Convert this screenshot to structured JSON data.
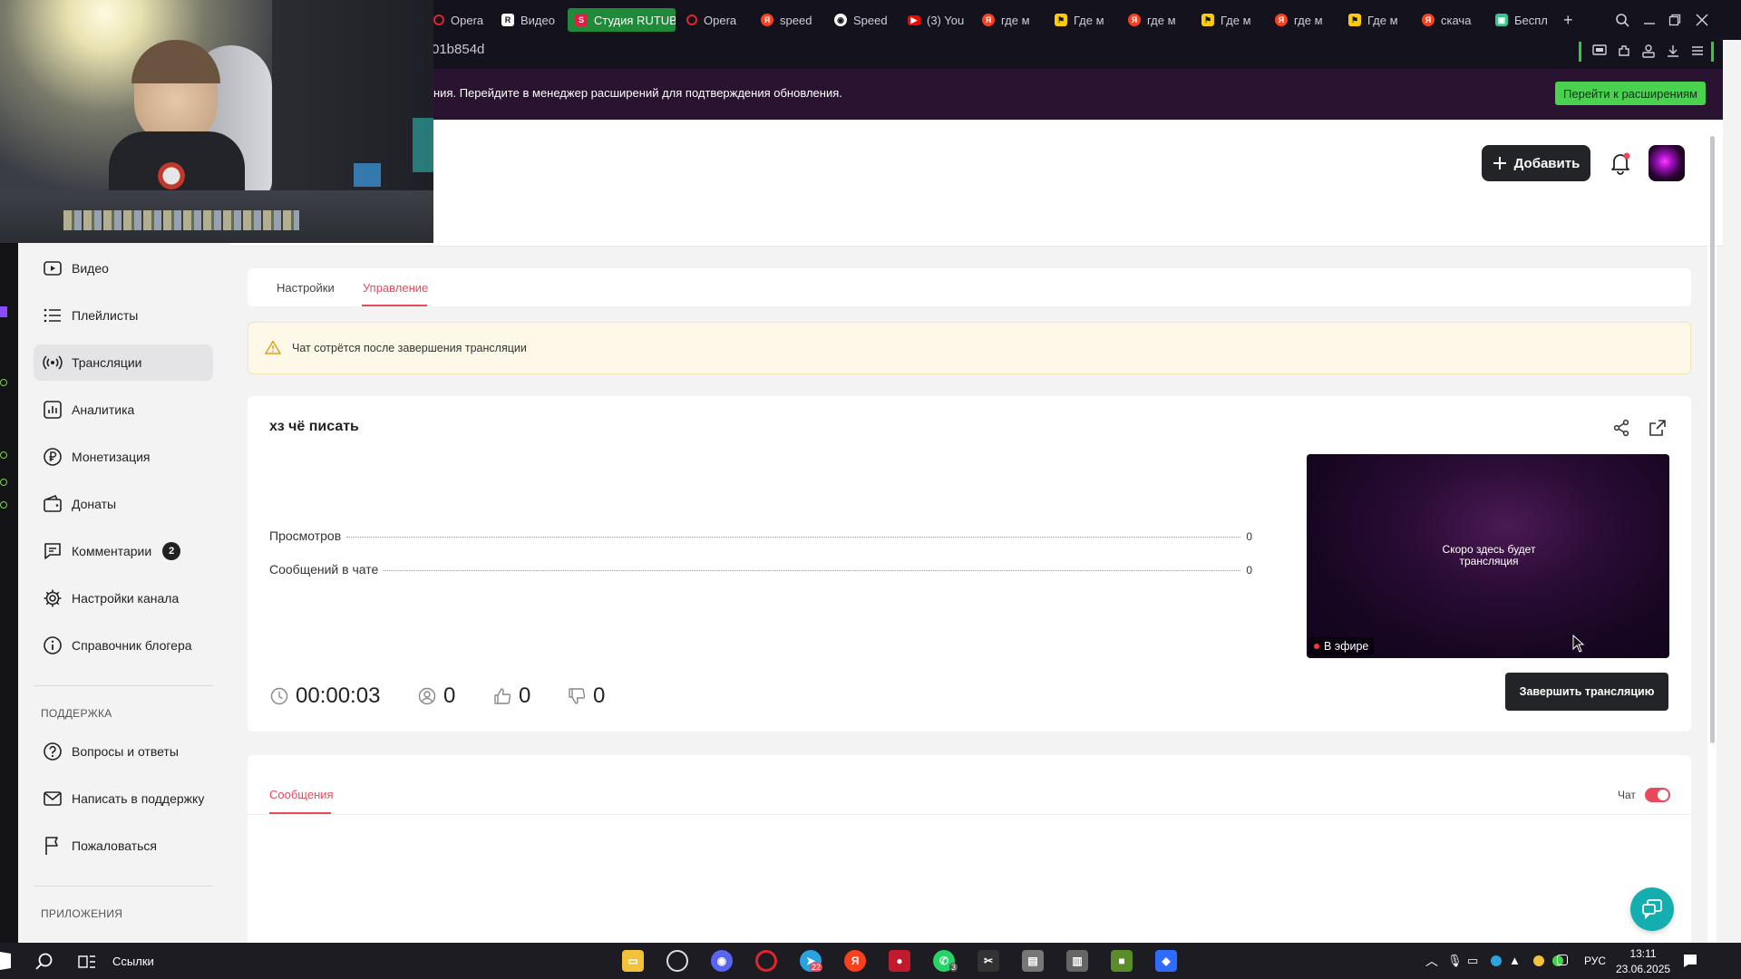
{
  "browser": {
    "tabs": [
      {
        "label": "Opera",
        "icon": "opera-icon",
        "color": "#e0262b"
      },
      {
        "label": "Видео",
        "icon": "rutube-icon",
        "color": "#ffffff"
      },
      {
        "label": "Студия RUTUBE",
        "icon": "rutube-studio-icon",
        "color": "#e01f45",
        "active": true
      },
      {
        "label": "Opera",
        "icon": "opera-icon",
        "color": "#e0262b"
      },
      {
        "label": "speed",
        "icon": "yandex-icon",
        "color": "#fc3f1d"
      },
      {
        "label": "Speed",
        "icon": "github-icon",
        "color": "#ffffff"
      },
      {
        "label": "(3) You",
        "icon": "youtube-icon",
        "color": "#ff0000"
      },
      {
        "label": "где м",
        "icon": "yandex-icon",
        "color": "#fc3f1d"
      },
      {
        "label": "Где м",
        "icon": "yandex-maps-icon",
        "color": "#ffcc00"
      },
      {
        "label": "где м",
        "icon": "yandex-icon",
        "color": "#fc3f1d"
      },
      {
        "label": "Где м",
        "icon": "yandex-maps-icon",
        "color": "#ffcc00"
      },
      {
        "label": "где м",
        "icon": "yandex-icon",
        "color": "#fc3f1d"
      },
      {
        "label": "Где м",
        "icon": "yandex-maps-icon",
        "color": "#ffcc00"
      },
      {
        "label": "скача",
        "icon": "yandex-icon",
        "color": "#fc3f1d"
      },
      {
        "label": "Беспл",
        "icon": "free-icon",
        "color": "#3bc48d"
      }
    ],
    "address": "01b854d",
    "notice_text": "ния. Перейдите в менеджер расширений для подтверждения обновления.",
    "notice_button": "Перейти к расширениям"
  },
  "header": {
    "add_label": "Добавить"
  },
  "sidebar": {
    "items": [
      {
        "label": "Видео",
        "icon": "video-icon"
      },
      {
        "label": "Плейлисты",
        "icon": "list-icon"
      },
      {
        "label": "Трансляции",
        "icon": "broadcast-icon",
        "active": true
      },
      {
        "label": "Аналитика",
        "icon": "analytics-icon"
      },
      {
        "label": "Монетизация",
        "icon": "ruble-icon"
      },
      {
        "label": "Донаты",
        "icon": "wallet-icon"
      },
      {
        "label": "Комментарии",
        "icon": "comment-icon",
        "badge": "2"
      },
      {
        "label": "Настройки канала",
        "icon": "gear-icon"
      },
      {
        "label": "Справочник блогера",
        "icon": "info-icon"
      }
    ],
    "support_heading": "ПОДДЕРЖКА",
    "support": [
      {
        "label": "Вопросы и ответы",
        "icon": "question-icon"
      },
      {
        "label": "Написать в поддержку",
        "icon": "mail-icon"
      },
      {
        "label": "Пожаловаться",
        "icon": "flag-icon"
      }
    ],
    "apps_heading": "ПРИЛОЖЕНИЯ"
  },
  "main": {
    "tabs": [
      {
        "label": "Настройки"
      },
      {
        "label": "Управление",
        "active": true
      }
    ],
    "warning": "Чат сотрётся после завершения трансляции",
    "title": "хз чё писать",
    "stats": [
      {
        "label": "Просмотров",
        "value": "0"
      },
      {
        "label": "Сообщений в чате",
        "value": "0"
      }
    ],
    "preview_text": "Скоро здесь будет трансляция",
    "live_label": "В эфире",
    "end_button": "Завершить трансляцию",
    "duration": "00:00:03",
    "viewers": "0",
    "likes": "0",
    "dislikes": "0",
    "messages_tab": "Сообщения",
    "chat_label": "Чат",
    "chat_enabled": true,
    "accent_color": "#e94a5b"
  },
  "taskbar": {
    "search_label": "Ссылки",
    "lang": "РУС",
    "time": "13:11",
    "date": "23.06.2025",
    "badges": {
      "telegram": "22",
      "whatsapp": "3"
    }
  }
}
